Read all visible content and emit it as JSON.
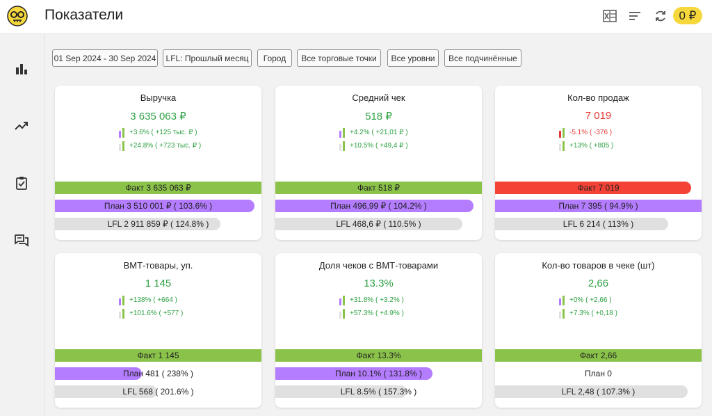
{
  "app": {
    "title": "Показатели",
    "balance": "0 ₽"
  },
  "icons": {
    "logo": "skull-glasses-logo-icon",
    "excel": "excel-icon",
    "sort": "sort-lines-icon",
    "refresh": "refresh-icon",
    "nav": [
      "bar-chart-icon",
      "trending-up-icon",
      "clipboard-check-icon",
      "chat-icon"
    ]
  },
  "colors": {
    "fact": "#8bc34a",
    "plan": "#b47cff",
    "lfl": "#e0e0e0",
    "fact_negative": "#f44336",
    "up": "#2ea043",
    "down": "#e53935",
    "balance": "#f7d83c"
  },
  "filters": [
    "01 Sep 2024 - 30 Sep 2024",
    "LFL: Прошлый месяц",
    "Город",
    "Все торговые точки",
    "Все уровни",
    "Все подчинённые"
  ],
  "cards": [
    {
      "title": "Выручка",
      "value": "3 635 063 ₽",
      "value_status": "up",
      "delta1": "+3.6% ( +125 тыс. ₽ )",
      "delta1_status": "up",
      "delta2": "+24.8% ( +723 тыс. ₽ )",
      "delta2_status": "up",
      "fact_label": "Факт 3 635 063 ₽",
      "fact_fill": 1.0,
      "fact_status": "up",
      "plan_label": "План 3 510 001 ₽ ( 103.6% )",
      "plan_fill": 0.966,
      "lfl_label": "LFL 2 911 859 ₽ ( 124.8% )",
      "lfl_fill": 0.802
    },
    {
      "title": "Средний чек",
      "value": "518 ₽",
      "value_status": "up",
      "delta1": "+4.2% ( +21,01 ₽ )",
      "delta1_status": "up",
      "delta2": "+10.5% ( +49,4 ₽ )",
      "delta2_status": "up",
      "fact_label": "Факт 518 ₽",
      "fact_fill": 1.0,
      "fact_status": "up",
      "plan_label": "План 496,99 ₽ ( 104.2% )",
      "plan_fill": 0.96,
      "lfl_label": "LFL 468,6 ₽ ( 110.5% )",
      "lfl_fill": 0.905
    },
    {
      "title": "Кол-во продаж",
      "value": "7 019",
      "value_status": "down",
      "delta1": "-5.1% ( -376 )",
      "delta1_status": "down",
      "delta2": "+13% ( +805 )",
      "delta2_status": "up",
      "fact_label": "Факт 7 019",
      "fact_fill": 0.949,
      "fact_status": "down",
      "plan_label": "План 7 395  ( 94.9% )",
      "plan_fill": 1.0,
      "lfl_label": "LFL 6 214  ( 113% )",
      "lfl_fill": 0.84
    },
    {
      "title": "ВМТ-товары, уп.",
      "value": "1 145",
      "value_status": "up",
      "delta1": "+138% ( +664 )",
      "delta1_status": "up",
      "delta2": "+101.6% ( +577 )",
      "delta2_status": "up",
      "fact_label": "Факт 1 145",
      "fact_fill": 1.0,
      "fact_status": "up",
      "plan_label": "План 481  ( 238% )",
      "plan_fill": 0.42,
      "lfl_label": "LFL 568  ( 201.6% )",
      "lfl_fill": 0.496
    },
    {
      "title": "Доля чеков с ВМТ-товарами",
      "value": "13.3%",
      "value_status": "up",
      "delta1": "+31.8% ( +3.2% )",
      "delta1_status": "up",
      "delta2": "+57.3% ( +4.9% )",
      "delta2_status": "up",
      "fact_label": "Факт 13.3%",
      "fact_fill": 1.0,
      "fact_status": "up",
      "plan_label": "План 10.1% ( 131.8% )",
      "plan_fill": 0.76,
      "lfl_label": "LFL 8.5% ( 157.3% )",
      "lfl_fill": 0.636
    },
    {
      "title": "Кол-во товаров в чеке (шт)",
      "value": "2,66",
      "value_status": "up",
      "delta1": "+0% ( +2,66 )",
      "delta1_status": "up",
      "delta2": "+7.3% ( +0,18 )",
      "delta2_status": "up",
      "fact_label": "Факт 2,66",
      "fact_fill": 1.0,
      "fact_status": "up",
      "plan_label": "План 0",
      "plan_fill": 0.0,
      "lfl_label": "LFL 2,48  ( 107.3% )",
      "lfl_fill": 0.932
    }
  ]
}
